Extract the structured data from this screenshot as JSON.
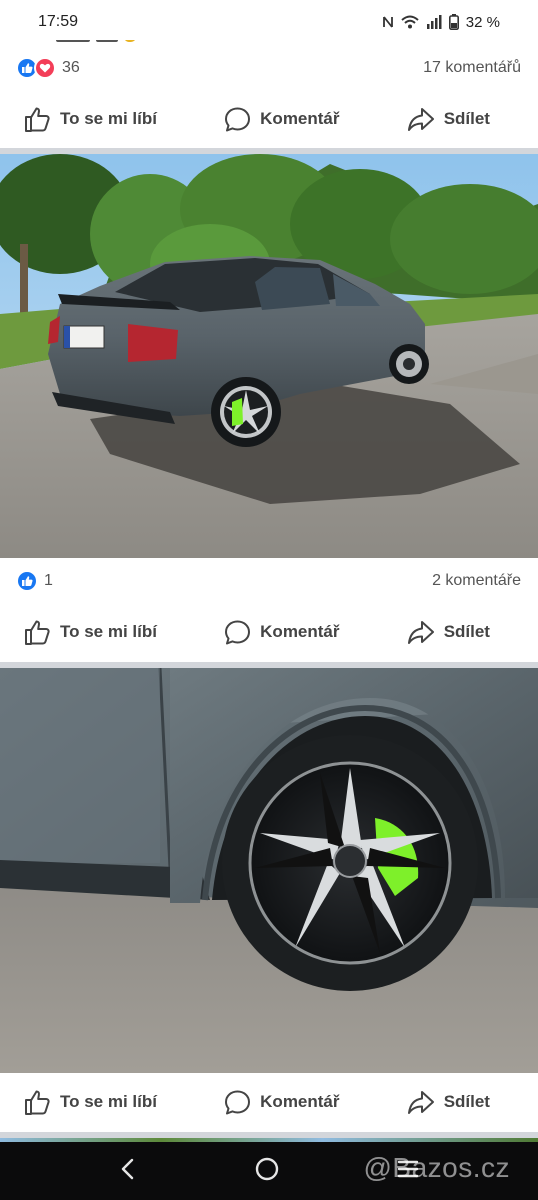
{
  "status_bar": {
    "time": "17:59",
    "battery": "32 %",
    "icons": [
      "nfc-icon",
      "wifi-icon",
      "signal-icon",
      "battery-icon"
    ]
  },
  "post1": {
    "reaction_count": "36",
    "comments": "17 komentářů",
    "reactions": [
      "like-icon",
      "love-icon"
    ]
  },
  "post2": {
    "reaction_count": "1",
    "comments": "2 komentáře",
    "reactions": [
      "like-icon"
    ]
  },
  "actions": {
    "like": "To se mi líbí",
    "comment": "Komentář",
    "share": "Sdílet"
  },
  "nav": {
    "icons": [
      "back-icon",
      "home-icon",
      "recents-icon"
    ]
  },
  "watermark": "@Bazos.cz",
  "colors": {
    "like_blue": "#1877f2",
    "love_red": "#f33e58",
    "car_grey": "#505a60",
    "caliper_green": "#7ef02a"
  }
}
